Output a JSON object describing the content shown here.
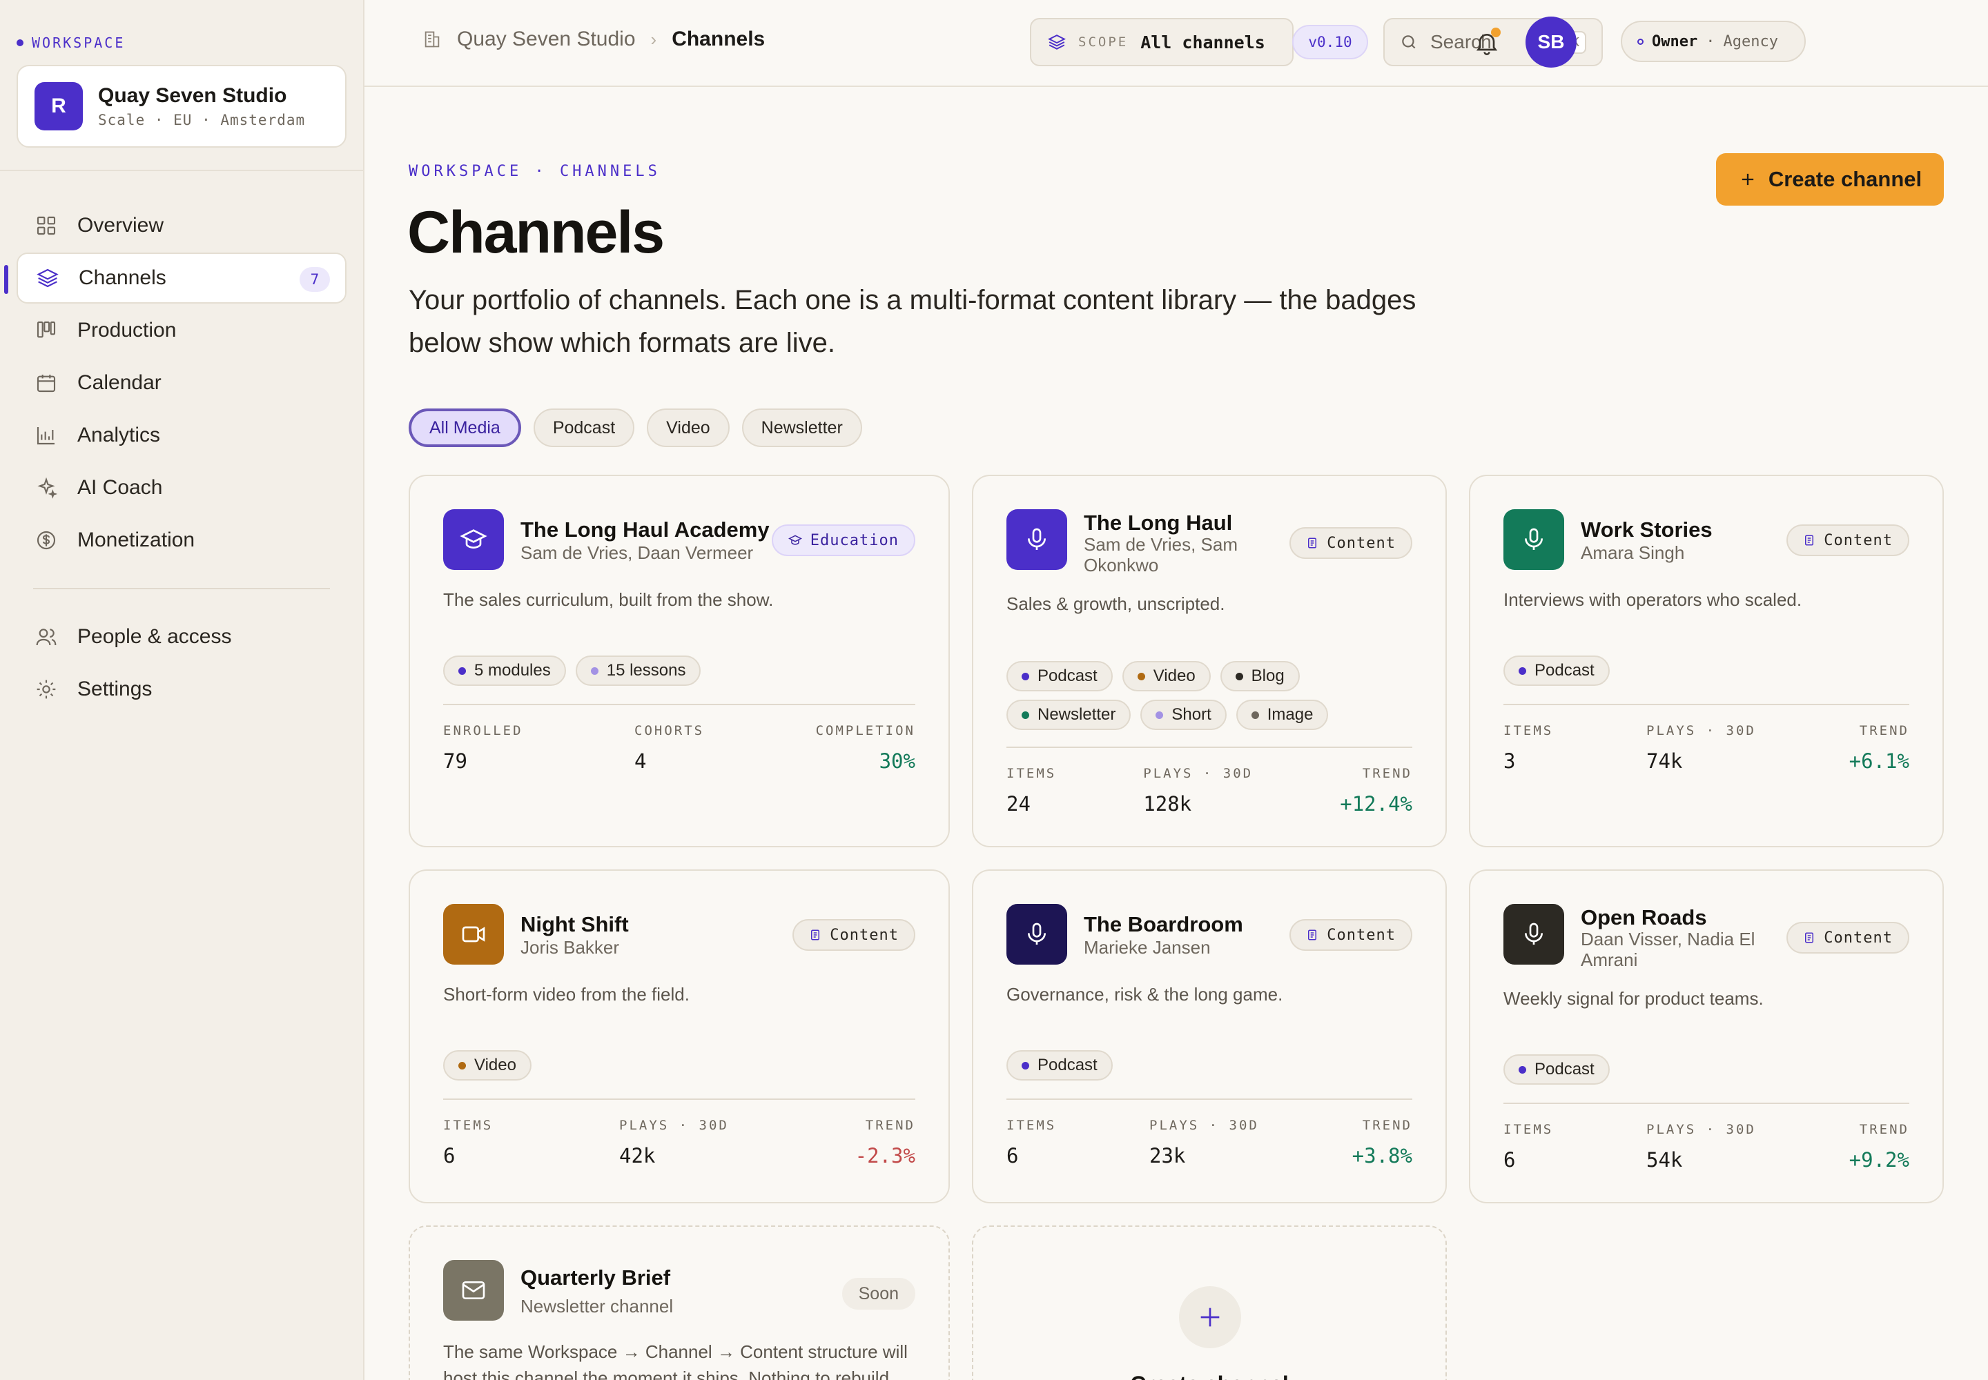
{
  "sidebar": {
    "workspace_label": "WORKSPACE",
    "workspace": {
      "initial": "R",
      "name": "Quay Seven Studio",
      "meta": "Scale · EU · Amsterdam"
    },
    "nav": [
      {
        "label": "Overview",
        "icon": "grid-icon"
      },
      {
        "label": "Channels",
        "icon": "layers-icon",
        "badge": "7",
        "active": true
      },
      {
        "label": "Production",
        "icon": "kanban-icon"
      },
      {
        "label": "Calendar",
        "icon": "calendar-icon"
      },
      {
        "label": "Analytics",
        "icon": "bar-chart-icon"
      },
      {
        "label": "AI Coach",
        "icon": "sparkle-icon"
      },
      {
        "label": "Monetization",
        "icon": "dollar-icon"
      }
    ],
    "nav_secondary": [
      {
        "label": "People & access",
        "icon": "people-icon"
      },
      {
        "label": "Settings",
        "icon": "gear-icon"
      }
    ]
  },
  "topbar": {
    "breadcrumb": [
      "Quay Seven Studio",
      "Channels"
    ],
    "scope_label": "SCOPE",
    "scope_value": "All channels",
    "version": "v0.10",
    "search_placeholder": "Search",
    "search_shortcut": "⌘K",
    "role": "Owner",
    "role_sep": "·",
    "org_type": "Agency",
    "user_initials": "SB"
  },
  "page": {
    "eyebrow": "WORKSPACE · CHANNELS",
    "title": "Channels",
    "lead": "Your portfolio of channels. Each one is a multi-format content library — the badges below show which formats are live.",
    "create_label": "Create channel",
    "filters": [
      "All Media",
      "Podcast",
      "Video",
      "Newsletter"
    ]
  },
  "colors": {
    "accent": "#4b2fc9",
    "cta": "#f2a12e",
    "trend_up": "#137a59",
    "trend_down": "#c24a4a"
  },
  "cards": [
    {
      "title": "The Long Haul Academy",
      "owners": "Sam de Vries, Daan Vermeer",
      "tag": "Education",
      "desc": "The sales curriculum, built from the show.",
      "badges": [
        "5 modules",
        "15 lessons"
      ],
      "stats": [
        {
          "k": "ENROLLED",
          "v": "79"
        },
        {
          "k": "COHORTS",
          "v": "4"
        },
        {
          "k": "COMPLETION",
          "v": "30%"
        }
      ],
      "icon_color": "#4b2fc9"
    },
    {
      "title": "The Long Haul",
      "owners": "Sam de Vries, Sam Okonkwo",
      "tag": "Content",
      "desc": "Sales & growth, unscripted.",
      "badges": [
        "Podcast",
        "Video",
        "Blog",
        "Newsletter",
        "Short",
        "Image"
      ],
      "stats": [
        {
          "k": "ITEMS",
          "v": "24"
        },
        {
          "k": "PLAYS · 30D",
          "v": "128k"
        },
        {
          "k": "TREND",
          "v": "+12.4%"
        }
      ],
      "icon_color": "#4b2fc9"
    },
    {
      "title": "Work Stories",
      "owners": "Amara Singh",
      "tag": "Content",
      "desc": "Interviews with operators who scaled.",
      "badges": [
        "Podcast"
      ],
      "stats": [
        {
          "k": "ITEMS",
          "v": "3"
        },
        {
          "k": "PLAYS · 30D",
          "v": "74k"
        },
        {
          "k": "TREND",
          "v": "+6.1%"
        }
      ],
      "icon_color": "#137a59"
    },
    {
      "title": "Night Shift",
      "owners": "Joris Bakker",
      "tag": "Content",
      "desc": "Short-form video from the field.",
      "badges": [
        "Video"
      ],
      "stats": [
        {
          "k": "ITEMS",
          "v": "6"
        },
        {
          "k": "PLAYS · 30D",
          "v": "42k"
        },
        {
          "k": "TREND",
          "v": "-2.3%"
        }
      ],
      "icon_color": "#b06a12"
    },
    {
      "title": "The Boardroom",
      "owners": "Marieke Jansen",
      "tag": "Content",
      "desc": "Governance, risk & the long game.",
      "badges": [
        "Podcast"
      ],
      "stats": [
        {
          "k": "ITEMS",
          "v": "6"
        },
        {
          "k": "PLAYS · 30D",
          "v": "23k"
        },
        {
          "k": "TREND",
          "v": "+3.8%"
        }
      ],
      "icon_color": "#1d1554"
    },
    {
      "title": "Open Roads",
      "owners": "Daan Visser, Nadia El Amrani",
      "tag": "Content",
      "desc": "Weekly signal for product teams.",
      "badges": [
        "Podcast"
      ],
      "stats": [
        {
          "k": "ITEMS",
          "v": "6"
        },
        {
          "k": "PLAYS · 30D",
          "v": "54k"
        },
        {
          "k": "TREND",
          "v": "+9.2%"
        }
      ],
      "icon_color": "#2c2923"
    },
    {
      "title": "Quarterly Brief",
      "owners": "Newsletter channel",
      "tag": "Soon",
      "desc": "The same Workspace → Channel → Content structure will host this channel the moment it ships. Nothing to rebuild.",
      "icon_color": "#7a7565"
    }
  ],
  "new_card": {
    "label": "Create channel"
  }
}
